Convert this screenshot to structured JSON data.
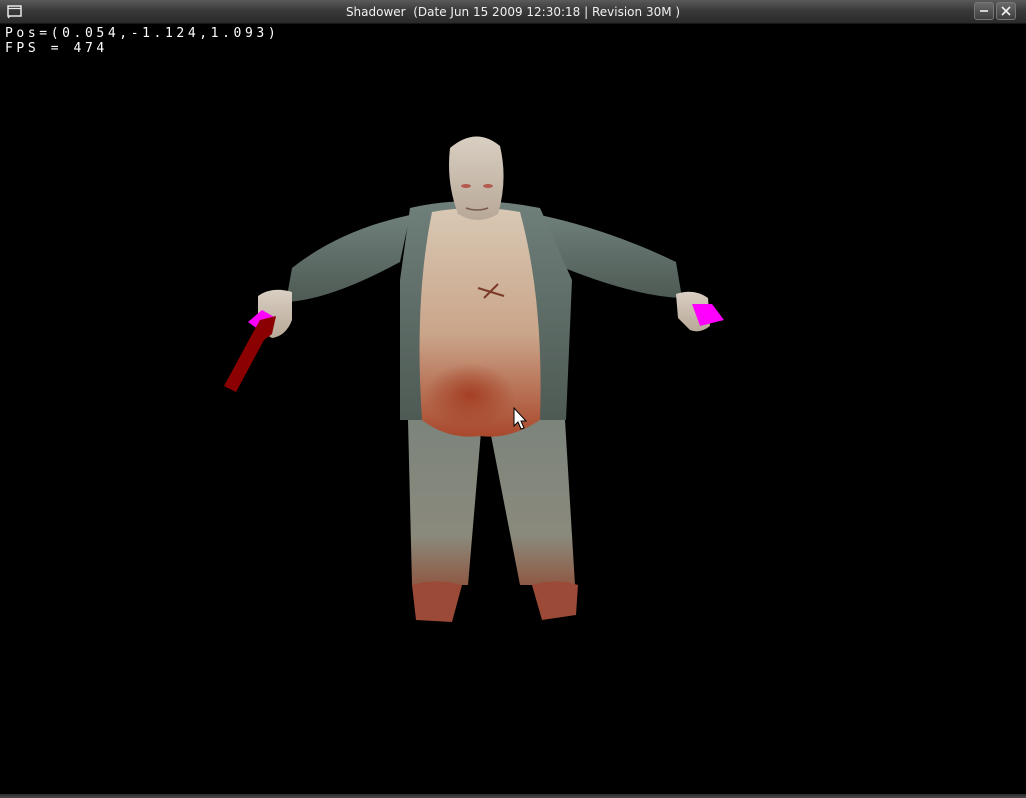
{
  "window": {
    "title": "Shadower  (Date Jun 15 2009 12:30:18 | Revision 30M )",
    "buttons": [
      "minimize-icon",
      "close-icon"
    ]
  },
  "hud": {
    "pos_label": "Pos=(0.054,-1.124,1.093)",
    "fps_label": "FPS = 474"
  },
  "scene": {
    "background": "#000000",
    "model_highlight_color": "#ff00ff",
    "weapon_color": "#8b0000"
  }
}
